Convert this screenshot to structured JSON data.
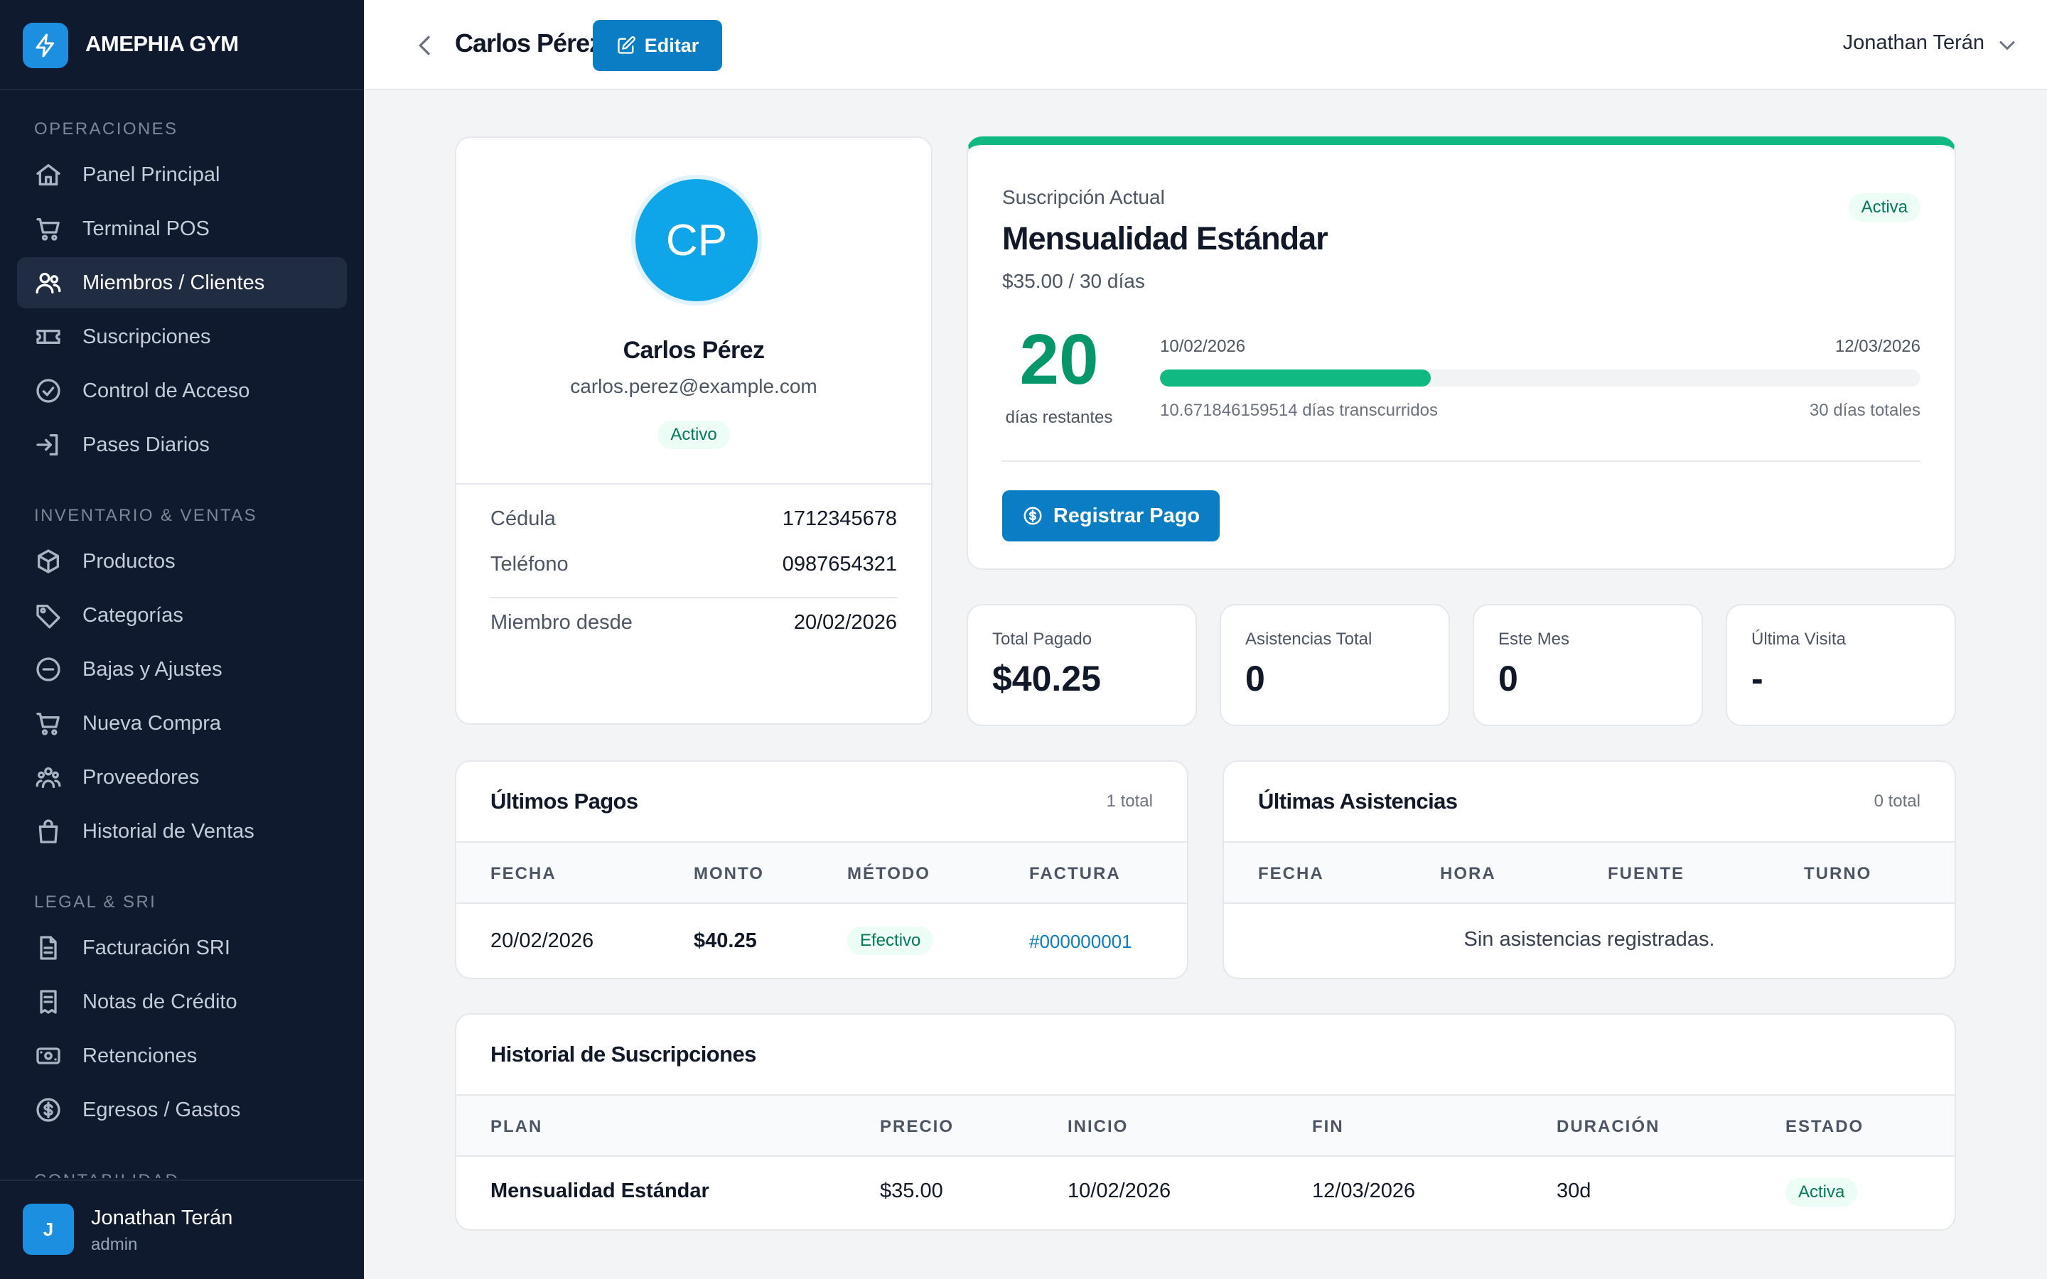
{
  "brand": {
    "name": "AMEPHIA GYM"
  },
  "sidebar": {
    "sections": [
      {
        "title": "OPERACIONES",
        "items": [
          {
            "label": "Panel Principal",
            "icon": "home-icon",
            "active": false
          },
          {
            "label": "Terminal POS",
            "icon": "cart-icon",
            "active": false
          },
          {
            "label": "Miembros / Clientes",
            "icon": "users-icon",
            "active": true
          },
          {
            "label": "Suscripciones",
            "icon": "ticket-icon",
            "active": false
          },
          {
            "label": "Control de Acceso",
            "icon": "check-circle-icon",
            "active": false
          },
          {
            "label": "Pases Diarios",
            "icon": "login-icon",
            "active": false
          }
        ]
      },
      {
        "title": "INVENTARIO & VENTAS",
        "items": [
          {
            "label": "Productos",
            "icon": "box-icon",
            "active": false
          },
          {
            "label": "Categorías",
            "icon": "tag-icon",
            "active": false
          },
          {
            "label": "Bajas y Ajustes",
            "icon": "minus-circle-icon",
            "active": false
          },
          {
            "label": "Nueva Compra",
            "icon": "cart-plus-icon",
            "active": false
          },
          {
            "label": "Proveedores",
            "icon": "people-group-icon",
            "active": false
          },
          {
            "label": "Historial de Ventas",
            "icon": "bag-icon",
            "active": false
          }
        ]
      },
      {
        "title": "LEGAL & SRI",
        "items": [
          {
            "label": "Facturación SRI",
            "icon": "document-icon",
            "active": false
          },
          {
            "label": "Notas de Crédito",
            "icon": "receipt-icon",
            "active": false
          },
          {
            "label": "Retenciones",
            "icon": "cash-icon",
            "active": false
          },
          {
            "label": "Egresos / Gastos",
            "icon": "dollar-circle-icon",
            "active": false
          }
        ]
      },
      {
        "title": "CONTABILIDAD",
        "items": []
      }
    ],
    "user": {
      "initial": "J",
      "name": "Jonathan Terán",
      "role": "admin"
    }
  },
  "header": {
    "title": "Carlos Pérez",
    "edit_label": "Editar",
    "user_name": "Jonathan Terán"
  },
  "profile": {
    "initials": "CP",
    "name": "Carlos Pérez",
    "email": "carlos.perez@example.com",
    "status": "Activo",
    "cedula_label": "Cédula",
    "cedula": "1712345678",
    "telefono_label": "Teléfono",
    "telefono": "0987654321",
    "miembro_label": "Miembro desde",
    "miembro_desde": "20/02/2026"
  },
  "subscription": {
    "label": "Suscripción Actual",
    "status": "Activa",
    "plan": "Mensualidad Estándar",
    "price": "$35.00 / 30 días",
    "days_left": "20",
    "days_left_label": "días restantes",
    "start": "10/02/2026",
    "end": "12/03/2026",
    "progress": 0.356,
    "elapsed": "10.671846159514 días transcurridos",
    "total": "30 días totales",
    "pay_label": "Registrar Pago",
    "accent": "#10b981"
  },
  "stats": [
    {
      "label": "Total Pagado",
      "value": "$40.25"
    },
    {
      "label": "Asistencias Total",
      "value": "0"
    },
    {
      "label": "Este Mes",
      "value": "0"
    },
    {
      "label": "Última Visita",
      "value": "-"
    }
  ],
  "payments": {
    "title": "Últimos Pagos",
    "count": "1 total",
    "columns": [
      "FECHA",
      "MONTO",
      "MÉTODO",
      "FACTURA"
    ],
    "rows": [
      {
        "fecha": "20/02/2026",
        "monto": "$40.25",
        "metodo": "Efectivo",
        "factura": "#000000001"
      }
    ]
  },
  "attendance": {
    "title": "Últimas Asistencias",
    "count": "0 total",
    "columns": [
      "FECHA",
      "HORA",
      "FUENTE",
      "TURNO"
    ],
    "empty": "Sin asistencias registradas."
  },
  "history": {
    "title": "Historial de Suscripciones",
    "columns": [
      "PLAN",
      "PRECIO",
      "INICIO",
      "FIN",
      "DURACIÓN",
      "ESTADO"
    ],
    "rows": [
      {
        "plan": "Mensualidad Estándar",
        "precio": "$35.00",
        "inicio": "10/02/2026",
        "fin": "12/03/2026",
        "duracion": "30d",
        "estado": "Activa"
      }
    ]
  },
  "colors": {
    "primary": "#0b7dc4",
    "success": "#10b981",
    "sidebar": "#0f1a2e"
  }
}
